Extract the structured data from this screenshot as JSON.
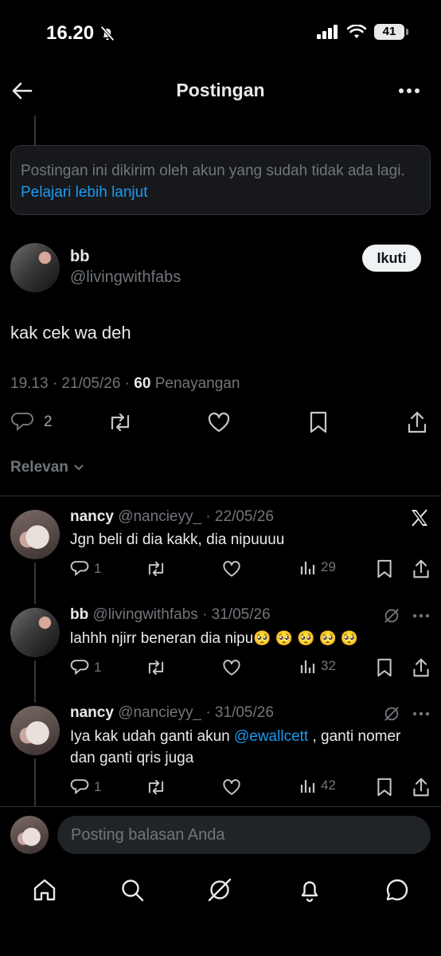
{
  "status_bar": {
    "time": "16.20",
    "battery": "41"
  },
  "header": {
    "title": "Postingan"
  },
  "notice": {
    "text": "Postingan ini dikirim oleh akun yang sudah tidak ada lagi.",
    "link": "Pelajari lebih lanjut"
  },
  "post": {
    "author_name": "bb",
    "author_handle": "@livingwithfabs",
    "follow_label": "Ikuti",
    "text": "kak cek wa deh",
    "meta_time": "19.13 · 21/05/26 · ",
    "views_count": "60",
    "views_label": " Penayangan",
    "reply_count": "2"
  },
  "sort": {
    "label": "Relevan"
  },
  "replies": [
    {
      "name": "nancy",
      "handle_date": "@nancieyy_ · 22/05/26",
      "text": "Jgn beli di dia kakk, dia nipuuuu",
      "replies": "1",
      "views": "29"
    },
    {
      "name": "bb",
      "handle_date": "@livingwithfabs · 31/05/26",
      "text": "lahhh njirr beneran dia nipu",
      "emoji": "🥺 🥺 🥺 🥺 🥺",
      "replies": "1",
      "views": "32"
    },
    {
      "name": "nancy",
      "handle_date": "@nancieyy_ · 31/05/26",
      "text_prefix": "Iya kak udah ganti akun ",
      "mention": "@ewallcett",
      "text_suffix": " , ganti nomer dan ganti qris juga",
      "replies": "1",
      "views": "42"
    }
  ],
  "composer": {
    "placeholder": "Posting balasan Anda"
  },
  "icons": {
    "back": "back-arrow-icon",
    "more": "more-dots-icon",
    "reply": "reply-icon",
    "repost": "repost-icon",
    "like": "like-icon",
    "bookmark": "bookmark-icon",
    "share": "share-icon",
    "views": "views-chart-icon",
    "grok": "grok-icon",
    "x_logo": "x-logo-icon",
    "nav": [
      "home-icon",
      "search-icon",
      "grok-icon",
      "notifications-icon",
      "messages-icon"
    ]
  }
}
